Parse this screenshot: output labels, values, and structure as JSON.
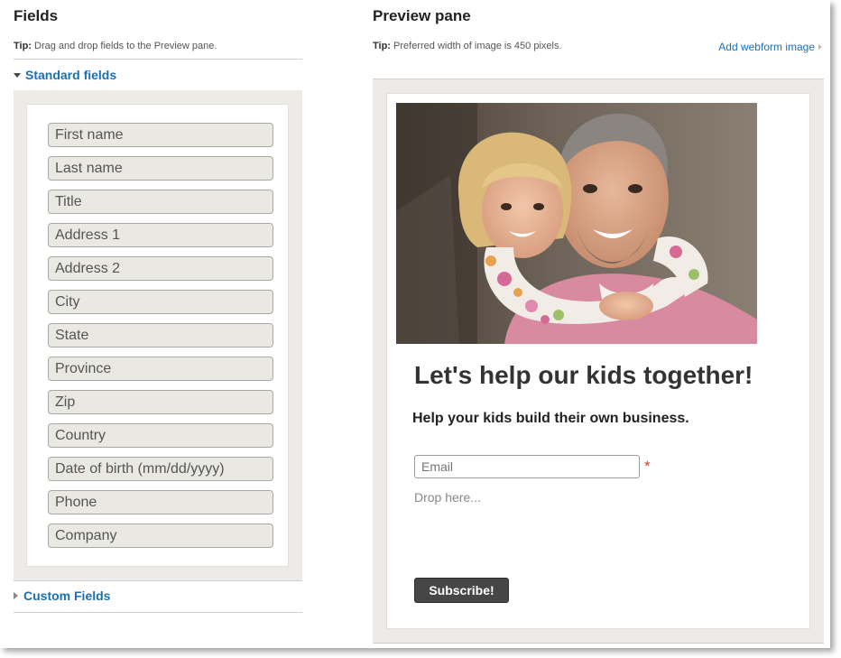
{
  "fields_panel": {
    "title": "Fields",
    "tip_label": "Tip:",
    "tip_text": "Drag and drop fields to the Preview pane.",
    "standard_section_label": "Standard fields",
    "standard_fields": [
      "First name",
      "Last name",
      "Title",
      "Address 1",
      "Address 2",
      "City",
      "State",
      "Province",
      "Zip",
      "Country",
      "Date of birth (mm/dd/yyyy)",
      "Phone",
      "Company"
    ],
    "custom_section_label": "Custom Fields"
  },
  "preview_pane": {
    "title": "Preview pane",
    "tip_label": "Tip:",
    "tip_text": "Preferred width of image is 450 pixels.",
    "add_image_link": "Add webform image",
    "form": {
      "headline": "Let's help our kids together!",
      "subheadline": "Help your kids build their own business.",
      "email_placeholder": "Email",
      "required_marker": "*",
      "drop_hint": "Drop here...",
      "submit_label": "Subscribe!"
    }
  },
  "colors": {
    "link_blue": "#1a6fb5",
    "well_gray": "#ecebe7",
    "chip_fill": "#e9e8e2",
    "button_dark": "#464646",
    "required_red": "#d2452b"
  }
}
